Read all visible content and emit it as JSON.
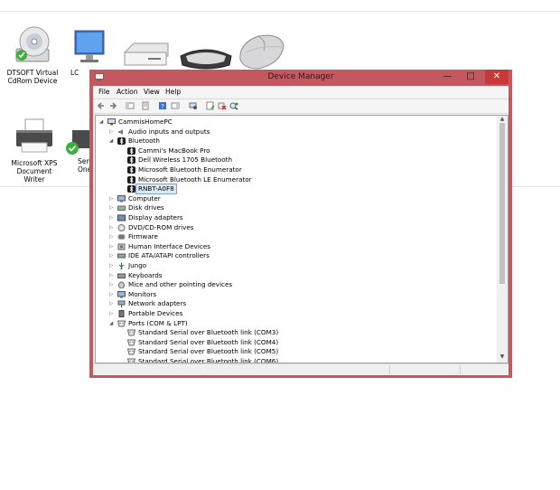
{
  "window": {
    "title": "Device Manager",
    "minimize": "—",
    "maximize": "□",
    "close": "✕"
  },
  "background_devices": [
    {
      "label": "DTSOFT Virtual CdRom Device",
      "icon": "cdrom-icon"
    },
    {
      "label": "LC",
      "icon": "monitor-icon"
    },
    {
      "label": "",
      "icon": "drive-icon"
    },
    {
      "label": "",
      "icon": "keyboard-icon"
    },
    {
      "label": "",
      "icon": "mouse-icon"
    },
    {
      "label": "Microsoft XPS Document Writer",
      "icon": "printer-icon"
    },
    {
      "label": "Sen OneN",
      "icon": "printer-icon"
    }
  ],
  "menu": [
    "File",
    "Action",
    "View",
    "Help"
  ],
  "tree": [
    {
      "label": "CammisHomePC",
      "level": 0,
      "expander": "◢",
      "icon": "computer-icon"
    },
    {
      "label": "Audio inputs and outputs",
      "level": 1,
      "expander": "▷",
      "icon": "speaker-icon"
    },
    {
      "label": "Bluetooth",
      "level": 1,
      "expander": "◢",
      "icon": "bluetooth-icon"
    },
    {
      "label": "Cammi's MacBook Pro",
      "level": 2,
      "expander": "",
      "icon": "bluetooth-icon"
    },
    {
      "label": "Dell Wireless 1705 Bluetooth",
      "level": 2,
      "expander": "",
      "icon": "bluetooth-icon"
    },
    {
      "label": "Microsoft Bluetooth Enumerator",
      "level": 2,
      "expander": "",
      "icon": "bluetooth-icon"
    },
    {
      "label": "Microsoft Bluetooth LE Enumerator",
      "level": 2,
      "expander": "",
      "icon": "bluetooth-icon"
    },
    {
      "label": "RNBT-A0F8",
      "level": 2,
      "expander": "",
      "icon": "bluetooth-icon",
      "selected": true
    },
    {
      "label": "Computer",
      "level": 1,
      "expander": "▷",
      "icon": "monitor-icon"
    },
    {
      "label": "Disk drives",
      "level": 1,
      "expander": "▷",
      "icon": "disk-icon"
    },
    {
      "label": "Display adapters",
      "level": 1,
      "expander": "▷",
      "icon": "display-icon"
    },
    {
      "label": "DVD/CD-ROM drives",
      "level": 1,
      "expander": "▷",
      "icon": "dvd-icon"
    },
    {
      "label": "Firmware",
      "level": 1,
      "expander": "▷",
      "icon": "chip-icon"
    },
    {
      "label": "Human Interface Devices",
      "level": 1,
      "expander": "▷",
      "icon": "hid-icon"
    },
    {
      "label": "IDE ATA/ATAPI controllers",
      "level": 1,
      "expander": "▷",
      "icon": "controller-icon"
    },
    {
      "label": "Jungo",
      "level": 1,
      "expander": "▷",
      "icon": "usb-icon"
    },
    {
      "label": "Keyboards",
      "level": 1,
      "expander": "▷",
      "icon": "keyboard-icon"
    },
    {
      "label": "Mice and other pointing devices",
      "level": 1,
      "expander": "▷",
      "icon": "mouse-icon"
    },
    {
      "label": "Monitors",
      "level": 1,
      "expander": "▷",
      "icon": "monitor-icon"
    },
    {
      "label": "Network adapters",
      "level": 1,
      "expander": "▷",
      "icon": "network-icon"
    },
    {
      "label": "Portable Devices",
      "level": 1,
      "expander": "▷",
      "icon": "portable-icon"
    },
    {
      "label": "Ports (COM & LPT)",
      "level": 1,
      "expander": "◢",
      "icon": "port-icon"
    },
    {
      "label": "Standard Serial over Bluetooth link (COM3)",
      "level": 2,
      "expander": "",
      "icon": "port-icon"
    },
    {
      "label": "Standard Serial over Bluetooth link (COM4)",
      "level": 2,
      "expander": "",
      "icon": "port-icon"
    },
    {
      "label": "Standard Serial over Bluetooth link (COM5)",
      "level": 2,
      "expander": "",
      "icon": "port-icon"
    },
    {
      "label": "Standard Serial over Bluetooth link (COM6)",
      "level": 2,
      "expander": "",
      "icon": "port-icon"
    }
  ],
  "colors": {
    "window_frame": "#c4585f",
    "close_button": "#c83a3a",
    "selection": "#dbe9f7",
    "bluetooth": "#1b1b1b"
  }
}
